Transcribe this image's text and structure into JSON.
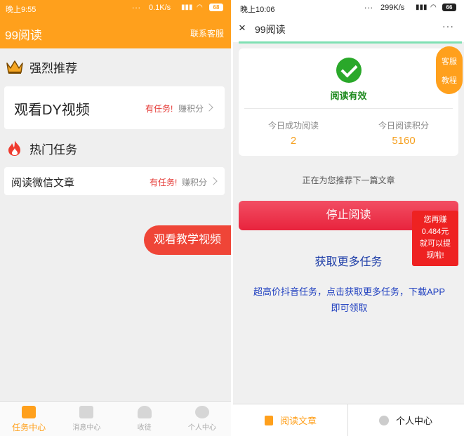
{
  "left": {
    "status": {
      "time": "晚上9:55",
      "dots": "...",
      "speed": "0.1K/s",
      "signal": "ull",
      "battery": "68"
    },
    "header": {
      "title": "99阅读",
      "contact": "联系客服"
    },
    "section_recommend": {
      "icon": "crown-icon",
      "title": "强烈推荐"
    },
    "card_dy": {
      "name": "观看DY视频",
      "task": "有任务!",
      "earn": "赚积分"
    },
    "section_hot": {
      "icon": "flame-icon",
      "title": "热门任务"
    },
    "card_wechat": {
      "name": "阅读微信文章",
      "task": "有任务!",
      "earn": "赚积分"
    },
    "tutorial_button": "观看教学视频",
    "tabs": [
      {
        "label": "任务中心",
        "icon": "task-icon",
        "active": true
      },
      {
        "label": "消息中心",
        "icon": "message-icon",
        "active": false
      },
      {
        "label": "收徒",
        "icon": "apprentice-icon",
        "active": false
      },
      {
        "label": "个人中心",
        "icon": "profile-icon",
        "active": false
      }
    ]
  },
  "right": {
    "status": {
      "time": "晚上10:06",
      "dots": "...",
      "speed": "299K/s",
      "signal": "ull",
      "battery": "66"
    },
    "nav": {
      "close": "×",
      "title": "99阅读",
      "more": "···"
    },
    "result": {
      "status_text": "阅读有效",
      "stats": [
        {
          "label": "今日成功阅读",
          "value": "2"
        },
        {
          "label": "今日阅读积分",
          "value": "5160"
        }
      ]
    },
    "side_pill": {
      "service": "客服",
      "tutorial": "教程"
    },
    "recommend_text": "正在为您推荐下一篇文章",
    "stop_button": "停止阅读",
    "promo": {
      "line1": "您再赚",
      "line2": "0.484元",
      "line3": "就可以提",
      "line4": "现啦!"
    },
    "more_tasks": "获取更多任务",
    "description": "超高价抖音任务，点击获取更多任务，下载APP即可领取",
    "tabs": [
      {
        "label": "阅读文章",
        "icon": "article-icon"
      },
      {
        "label": "个人中心",
        "icon": "user-icon"
      }
    ]
  },
  "colors": {
    "brand_orange": "#ffa01c",
    "red": "#ef4537",
    "green": "#2aa82a",
    "link_blue": "#1e3ea8"
  }
}
